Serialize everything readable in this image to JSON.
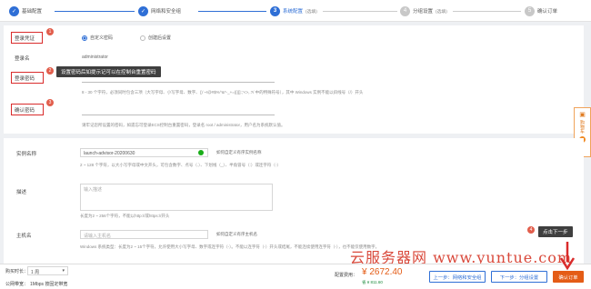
{
  "steps": [
    {
      "num": "✓",
      "label": "基础配置",
      "state": "done"
    },
    {
      "num": "✓",
      "label": "网络和安全组",
      "state": "done"
    },
    {
      "num": "3",
      "label": "系统配置",
      "sub": "(选填)",
      "state": "current"
    },
    {
      "num": "4",
      "label": "分组设置",
      "sub": "(选填)",
      "state": "todo"
    },
    {
      "num": "5",
      "label": "确认订单",
      "state": "todo"
    }
  ],
  "login": {
    "credential_label": "登录凭证",
    "credential_options": [
      "自定义密码",
      "创建后设置"
    ],
    "username_label": "登录名",
    "username_value": "administrator",
    "password_label": "登录密码",
    "password_hint": "8 - 30 个字符，必须同时包含三项（大写字母、小写字母、数字、()`~!@#$%^&*-_+=|{}[]:;'<>,.?/ 中的特殊符号），其中 Windows 实例不能以斜线号（/）开头",
    "confirm_label": "确认密码",
    "confirm_hint": "请牢记您所设置的密码，如遗忘可登录ECS控制台重置密码，登录名 root / administrator，用户名为系统默认值。",
    "tooltip": "设置密码后如提示记可以在控制台重置密码",
    "badges": [
      "1",
      "2",
      "3"
    ]
  },
  "instance": {
    "name_label": "实例名称",
    "name_value": "launch-advisor-20200630",
    "name_suffix": "如何自定义有序实例名称",
    "name_hint": "2 ~ 128 个字符，以大小写字母或中文开头，可包含数字、点号（.）、下划线（_）、半角冒号（:）或连字符（-）",
    "desc_label": "描述",
    "desc_placeholder": "输入描述",
    "desc_hint": "长度为2 ~ 256个字符，不能以http://或https://开头",
    "host_label": "主机名",
    "host_placeholder": "请输入主机名",
    "host_suffix": "如何自定义有序主机名",
    "host_hint": "Windows 系统类型：长度为2 ~ 15个字符，允许使用大小写字母、数字或连字符（-）。不能以连字符（-）开头或结尾，不能连续使用连字符（-），也不能仅使用数字。",
    "next_tip": "点击下一步",
    "next_badge": "4"
  },
  "cart": {
    "label": "购物车",
    "count": "1"
  },
  "footer": {
    "duration_label": "购买时长：",
    "duration_value": "1 周",
    "bandwidth_label": "公网带宽：",
    "bandwidth_value": "1Mbps 按固定带宽",
    "fee_label": "配置费用：",
    "fee_value": "¥ 2672.40",
    "fee_sub": "省 ¥ 811.60",
    "prev_button": "上一步：网络和安全组",
    "next_button": "下一步：分组设置",
    "confirm_button": "确认订单"
  },
  "watermark": "云服务器网 www.yuntue.com",
  "colors": {
    "accent": "#2f6fd6",
    "annotation": "#d92b2b",
    "orange": "#e45c16"
  }
}
